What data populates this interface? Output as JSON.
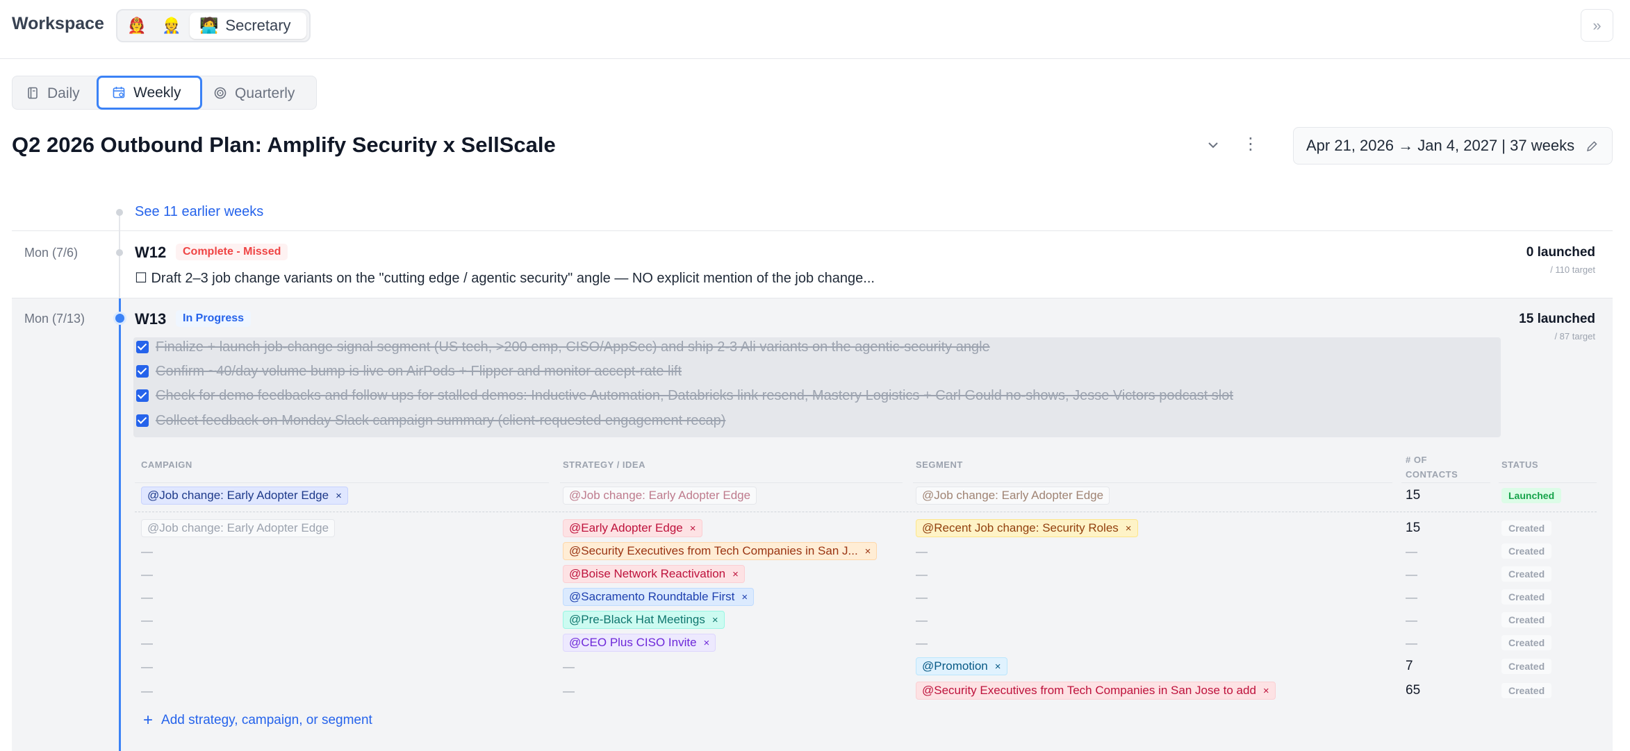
{
  "workspace": {
    "title": "Workspace",
    "personas": [
      {
        "icon": "🧑‍🚒"
      },
      {
        "icon": "👷"
      },
      {
        "icon": "🧑‍💻",
        "label": "Secretary"
      }
    ]
  },
  "tabs": [
    {
      "label": "Daily"
    },
    {
      "label": "Weekly"
    },
    {
      "label": "Quarterly"
    }
  ],
  "plan": {
    "title": "Q2 2026 Outbound Plan: Amplify Security x SellScale",
    "date_range": "Apr 21, 2026 → Jan 4, 2027 | 37 weeks"
  },
  "timeline": {
    "see_earlier": "See 11 earlier weeks"
  },
  "weeks": [
    {
      "date": "Mon (7/6)",
      "name": "W12",
      "status": "Complete - Missed",
      "launched": "0 launched",
      "target": "/ 110 target",
      "task": "☐ Draft 2–3 job change variants on the \"cutting edge / agentic security\" angle — NO explicit mention of the job change..."
    },
    {
      "date": "Mon (7/13)",
      "name": "W13",
      "status": "In Progress",
      "launched": "15 launched",
      "target": "/ 87 target",
      "tasks": [
        "Finalize + launch job-change signal segment (US tech, >200 emp, CISO/AppSec) and ship 2-3 Ali variants on the agentic-security angle",
        "Confirm ~40/day volume bump is live on AirPods + Flipper and monitor accept-rate lift",
        "Check for demo feedbacks and follow ups for stalled demos: Inductive Automation, Databricks link resend, Mastery Logistics + Carl Gould no-shows, Jesse Victors podcast slot",
        "Collect feedback on Monday Slack campaign summary (client-requested engagement recap)"
      ]
    }
  ],
  "table": {
    "headers": {
      "campaign": "CAMPAIGN",
      "strategy": "STRATEGY / IDEA",
      "segment": "SEGMENT",
      "contacts_1": "# OF",
      "contacts_2": "CONTACTS",
      "status": "STATUS"
    },
    "rows": [
      {
        "campaign": "@Job change: Early Adopter Edge",
        "strategy": "@Job change: Early Adopter Edge",
        "segment": "@Job change: Early Adopter Edge",
        "contacts": "15",
        "status": "Launched"
      },
      {
        "campaign": "@Job change: Early Adopter Edge",
        "strategy": "@Early Adopter Edge",
        "segment": "@Recent Job change: Security Roles",
        "contacts": "15",
        "status": "Created"
      },
      {
        "campaign": "—",
        "strategy": "@Security Executives from Tech Companies in San J...",
        "segment": "—",
        "contacts": "—",
        "status": "Created"
      },
      {
        "campaign": "—",
        "strategy": "@Boise Network Reactivation",
        "segment": "—",
        "contacts": "—",
        "status": "Created"
      },
      {
        "campaign": "—",
        "strategy": "@Sacramento Roundtable First",
        "segment": "—",
        "contacts": "—",
        "status": "Created"
      },
      {
        "campaign": "—",
        "strategy": "@Pre-Black Hat Meetings",
        "segment": "—",
        "contacts": "—",
        "status": "Created"
      },
      {
        "campaign": "—",
        "strategy": "@CEO Plus CISO Invite",
        "segment": "—",
        "contacts": "—",
        "status": "Created"
      },
      {
        "campaign": "—",
        "strategy": "—",
        "segment": "@Promotion",
        "contacts": "7",
        "status": "Created"
      },
      {
        "campaign": "—",
        "strategy": "—",
        "segment": "@Security Executives from Tech Companies in San Jose to add",
        "contacts": "65",
        "status": "Created"
      }
    ],
    "add_label": "Add strategy, campaign, or segment",
    "remove_glyph": "×"
  },
  "icons": {
    "collapse": "double-chevron-right-icon",
    "more": "⋮",
    "plus": "+"
  },
  "colors": {
    "accent": "#3b82f6",
    "missed": "#ef4444",
    "launched": "#16a34a"
  }
}
